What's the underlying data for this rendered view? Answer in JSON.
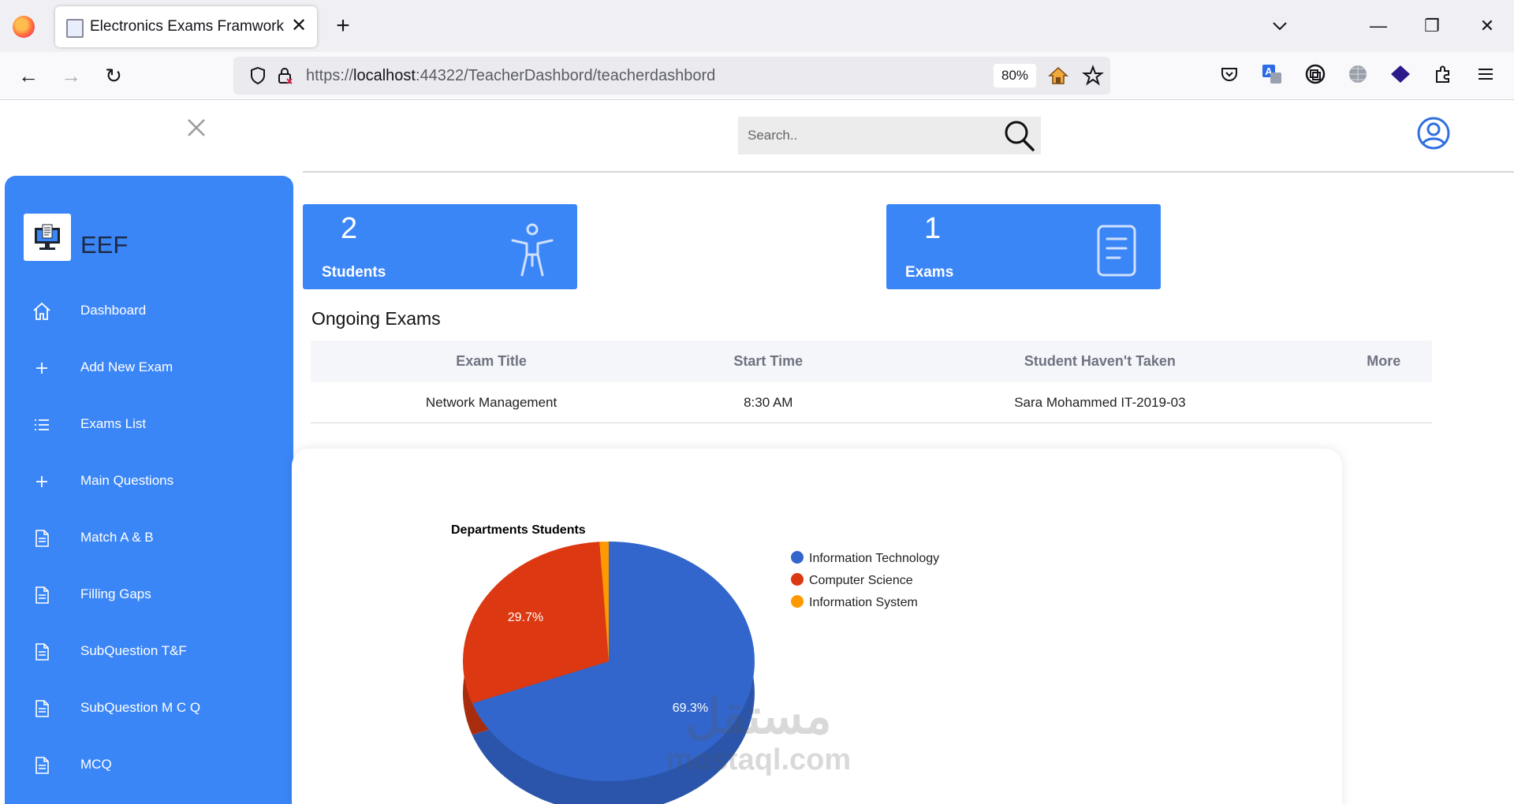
{
  "browser": {
    "tab_title": "Electronics Exams Framwork",
    "url_scheme": "https://",
    "url_host": "localhost",
    "url_rest": ":44322/TeacherDashbord/teacherdashbord",
    "zoom": "80%"
  },
  "sidebar": {
    "brand": "EEF",
    "items": [
      {
        "label": "Dashboard",
        "icon": "home-icon"
      },
      {
        "label": "Add New Exam",
        "icon": "plus-icon"
      },
      {
        "label": "Exams List",
        "icon": "list-icon"
      },
      {
        "label": "Main Questions",
        "icon": "plus-icon"
      },
      {
        "label": "Match A & B",
        "icon": "document-icon"
      },
      {
        "label": "Filling Gaps",
        "icon": "document-icon"
      },
      {
        "label": "SubQuestion T&F",
        "icon": "document-icon"
      },
      {
        "label": "SubQuestion M C Q",
        "icon": "document-icon"
      },
      {
        "label": "MCQ",
        "icon": "document-icon"
      }
    ]
  },
  "search": {
    "placeholder": "Search.."
  },
  "stats": {
    "students": {
      "value": "2",
      "label": "Students"
    },
    "exams": {
      "value": "1",
      "label": "Exams"
    }
  },
  "ongoing": {
    "title": "Ongoing Exams",
    "columns": [
      "Exam Title",
      "Start Time",
      "Student Haven't Taken",
      "More"
    ],
    "rows": [
      [
        "Network Management",
        "8:30 AM",
        "Sara Mohammed IT-2019-03",
        ""
      ]
    ]
  },
  "colors": {
    "accent": "#3b86f7",
    "pie_it": "#3366cc",
    "pie_cs": "#dc3912",
    "pie_is": "#ff9900"
  },
  "chart_data": {
    "type": "pie",
    "title": "Departments Students",
    "categories": [
      "Information Technology",
      "Computer Science",
      "Information System"
    ],
    "values": [
      69.3,
      29.7,
      1.0
    ],
    "labels": [
      "69.3%",
      "29.7%",
      ""
    ],
    "legend": "right"
  },
  "watermark": {
    "arabic": "مستقل",
    "latin": "mostaql.com"
  }
}
